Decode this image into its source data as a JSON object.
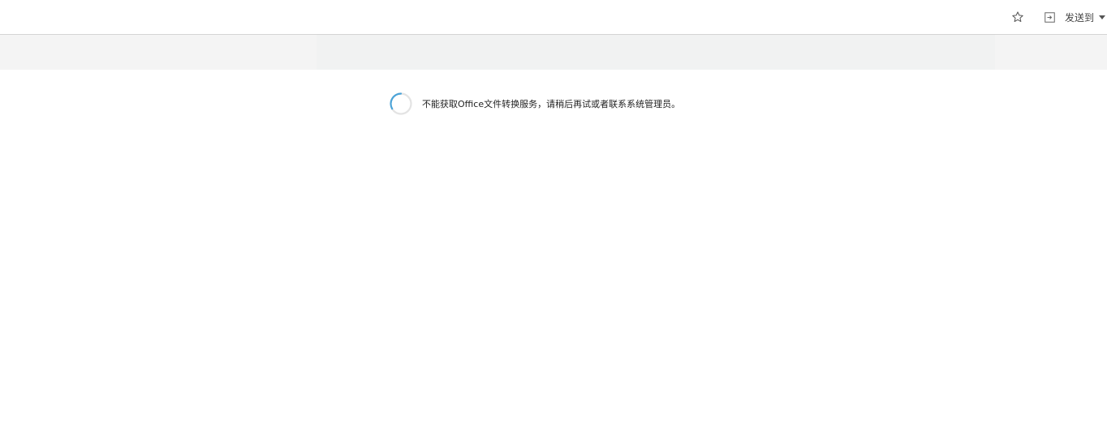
{
  "header": {
    "send_to_label": "发送到",
    "favorite_icon": "star-icon",
    "send_icon": "send-to-icon",
    "dropdown_icon": "caret-down-icon"
  },
  "viewer": {
    "loading_icon": "loading-spinner-icon",
    "status_message": "不能获取Office文件转换服务，请稍后再试或者联系系统管理员。",
    "spinner_color": "#4aa3d8"
  }
}
